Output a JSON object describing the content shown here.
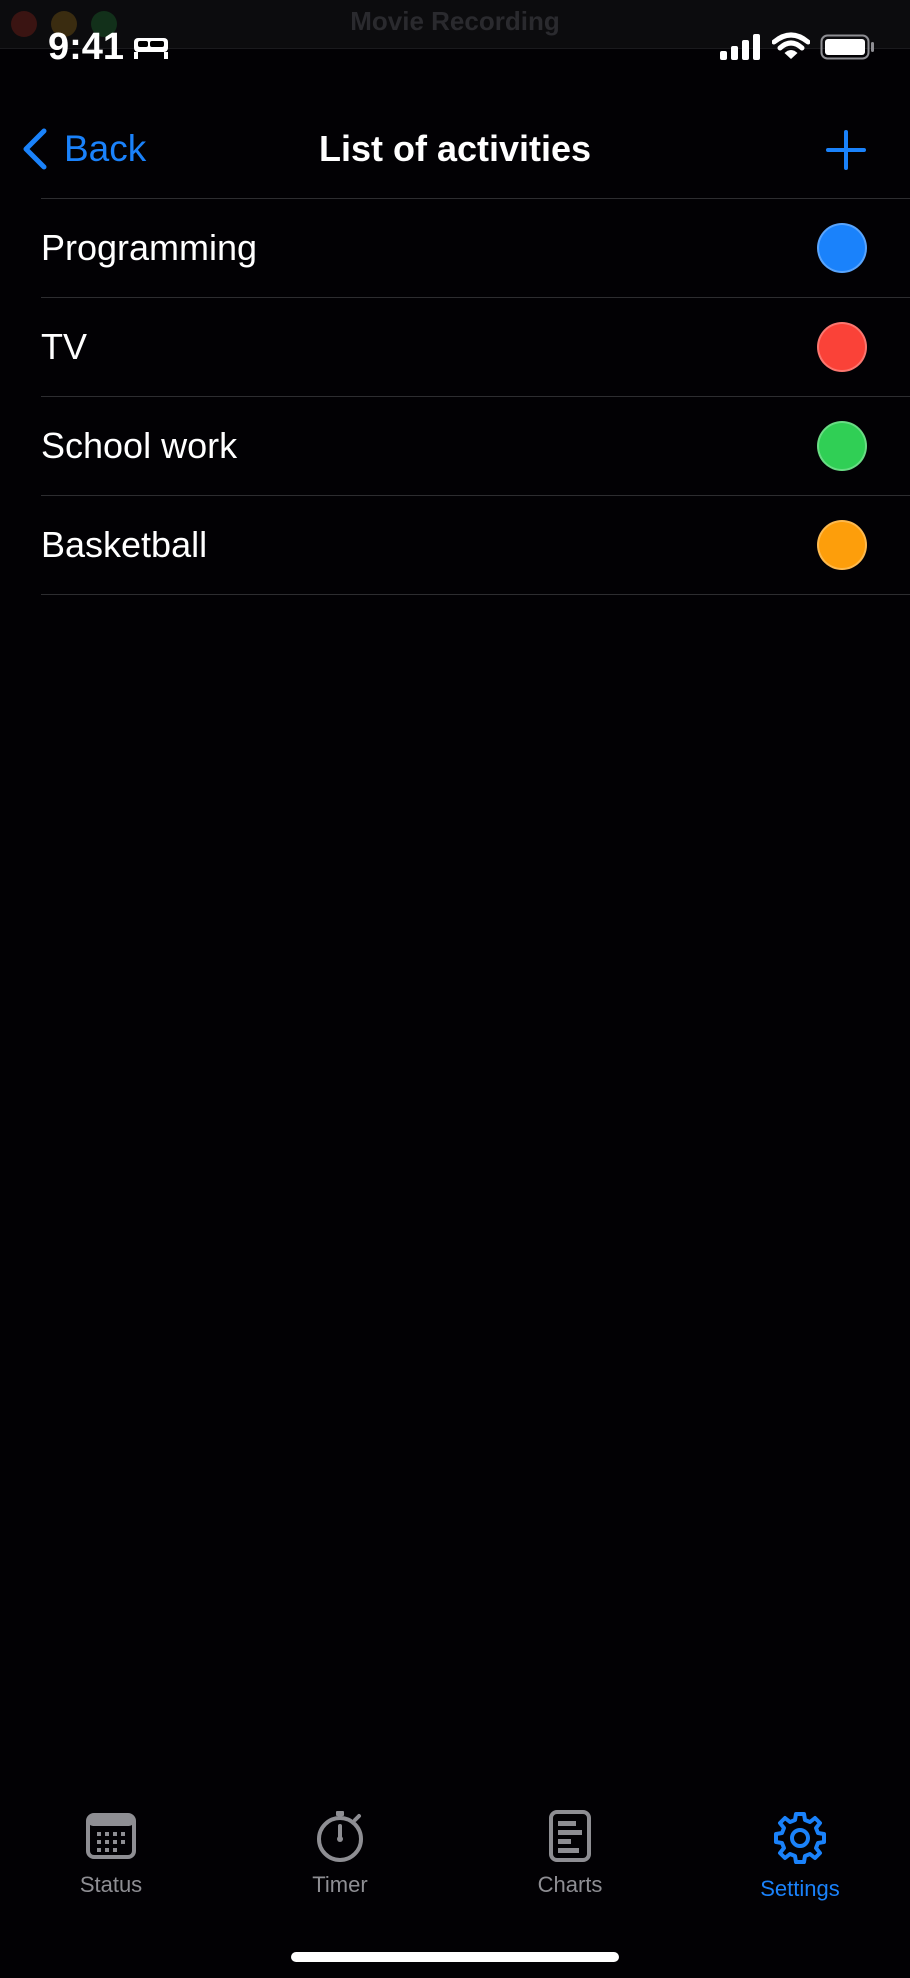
{
  "window": {
    "title": "Movie Recording"
  },
  "status_bar": {
    "time": "9:41",
    "icons": [
      "bed-icon",
      "cellular-signal-icon",
      "wifi-icon",
      "battery-icon"
    ]
  },
  "nav": {
    "back_label": "Back",
    "title": "List of activities",
    "add_icon": "plus-icon"
  },
  "activities": [
    {
      "name": "Programming",
      "color": "#1a82fb"
    },
    {
      "name": "TV",
      "color": "#fa4238"
    },
    {
      "name": "School work",
      "color": "#30cf55"
    },
    {
      "name": "Basketball",
      "color": "#fd9e0b"
    }
  ],
  "tabs": [
    {
      "label": "Status",
      "icon": "calendar-icon",
      "active": false
    },
    {
      "label": "Timer",
      "icon": "stopwatch-icon",
      "active": false
    },
    {
      "label": "Charts",
      "icon": "chart-icon",
      "active": false
    },
    {
      "label": "Settings",
      "icon": "gear-icon",
      "active": true
    }
  ],
  "colors": {
    "accent": "#1a82fb",
    "background": "#020104",
    "inactive": "#8e8e93"
  }
}
